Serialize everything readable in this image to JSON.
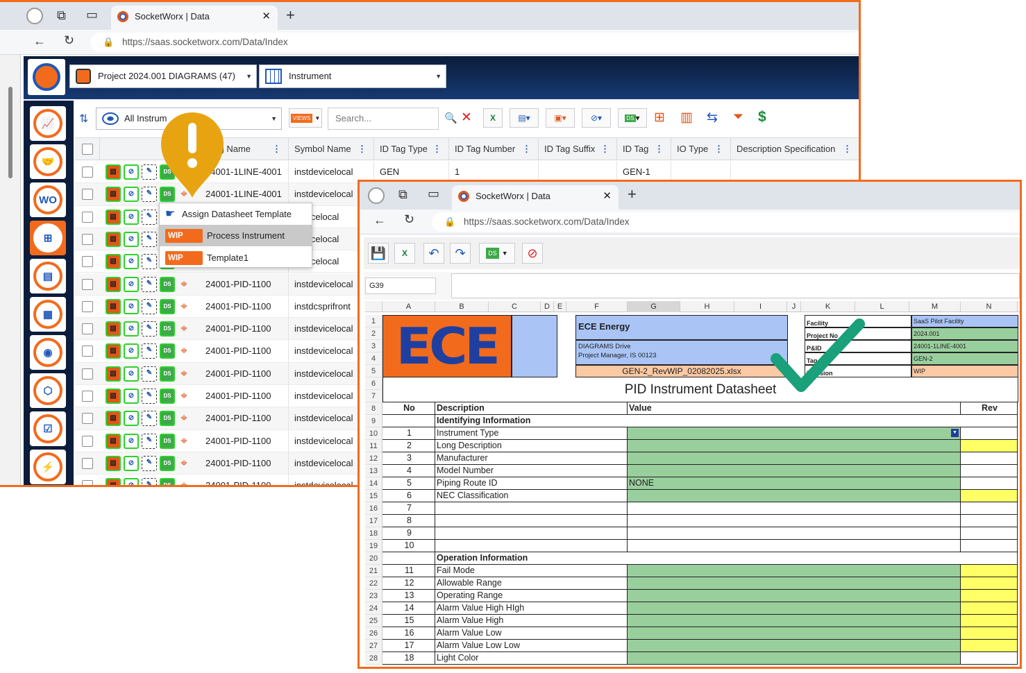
{
  "window1": {
    "tab_title": "SocketWorx | Data",
    "url": "https://saas.socketworx.com/Data/Index",
    "project_select": "Project 2024.001 DIAGRAMS (47)",
    "category_select": "Instrument",
    "filter_select": "All Instrum",
    "views_label": "VIEWS",
    "search_placeholder": "Search...",
    "columns": [
      "wing Name",
      "Symbol Name",
      "ID Tag Type",
      "ID Tag Number",
      "ID Tag Suffix",
      "ID Tag",
      "IO Type",
      "Description Specification"
    ],
    "rows": [
      {
        "drawing": "24001-1LINE-4001",
        "symbol": "instdevicelocal",
        "tag_type": "GEN",
        "tag_number": "1",
        "tag": "GEN-1"
      },
      {
        "drawing": "24001-1LINE-4001",
        "symbol": "instdevicelocal"
      },
      {
        "drawing": "",
        "symbol": "devicelocal"
      },
      {
        "drawing": "",
        "symbol": "devicelocal"
      },
      {
        "drawing": "",
        "symbol": "devicelocal"
      },
      {
        "drawing": "24001-PID-1100",
        "symbol": "instdevicelocal"
      },
      {
        "drawing": "24001-PID-1100",
        "symbol": "instdcsprifront"
      },
      {
        "drawing": "24001-PID-1100",
        "symbol": "instdevicelocal"
      },
      {
        "drawing": "24001-PID-1100",
        "symbol": "instdevicelocal"
      },
      {
        "drawing": "24001-PID-1100",
        "symbol": "instdevicelocal"
      },
      {
        "drawing": "24001-PID-1100",
        "symbol": "instdevicelocal"
      },
      {
        "drawing": "24001-PID-1100",
        "symbol": "instdevicelocal"
      },
      {
        "drawing": "24001-PID-1100",
        "symbol": "instdevicelocal"
      },
      {
        "drawing": "24001-PID-1100",
        "symbol": "instdevicelocal"
      },
      {
        "drawing": "24001-PID-1100",
        "symbol": "instdevicelocal"
      }
    ],
    "context_menu": {
      "title": "Assign Datasheet Template",
      "items": [
        {
          "badge": "WIP",
          "label": "Process Instrument"
        },
        {
          "badge": "WIP",
          "label": "Template1"
        }
      ]
    },
    "nav_icons": [
      "chart-icon",
      "handshake-icon",
      "work-order-icon",
      "grid-icon",
      "document-icon",
      "calendar-icon",
      "camera-icon",
      "cube-icon",
      "checklist-icon",
      "lightning-icon"
    ]
  },
  "window2": {
    "tab_title": "SocketWorx | Data",
    "url": "https://saas.socketworx.com/Data/Index",
    "cell_ref": "G39",
    "columns": [
      "A",
      "B",
      "C",
      "D",
      "E",
      "F",
      "G",
      "H",
      "I",
      "J",
      "K",
      "L",
      "M",
      "N"
    ],
    "logo_text": "ECE",
    "company": "ECE Energy",
    "address1": "DIAGRAMS Drive",
    "address2": "Project Manager, IS 00123",
    "filename": "GEN-2_RevWIP_02082025.xlsx",
    "info_labels": [
      "Facility",
      "Project No",
      "P&ID",
      "Tag",
      "Revision"
    ],
    "info_values": [
      "SaaS Pilot Facility",
      "2024.001",
      "24001-1LINE-4001",
      "GEN-2",
      "WIP"
    ],
    "sheet_title": "PID Instrument Datasheet",
    "header": {
      "no": "No",
      "description": "Description",
      "value": "Value",
      "rev": "Rev"
    },
    "sections": [
      {
        "row": 9,
        "title": "Identifying Information"
      },
      {
        "row": 20,
        "title": "Operation Information"
      }
    ],
    "items": [
      {
        "row": 10,
        "no": "1",
        "desc": "Instrument Type",
        "value": "",
        "green": true,
        "yellow": false
      },
      {
        "row": 11,
        "no": "2",
        "desc": "Long Description",
        "value": "",
        "green": true,
        "yellow": true
      },
      {
        "row": 12,
        "no": "3",
        "desc": "Manufacturer",
        "value": "",
        "green": true,
        "yellow": false
      },
      {
        "row": 13,
        "no": "4",
        "desc": "Model Number",
        "value": "",
        "green": true,
        "yellow": false
      },
      {
        "row": 14,
        "no": "5",
        "desc": "Piping Route ID",
        "value": "NONE",
        "green": true,
        "yellow": false
      },
      {
        "row": 15,
        "no": "6",
        "desc": "NEC Classification",
        "value": "",
        "green": true,
        "yellow": true
      },
      {
        "row": 16,
        "no": "7",
        "desc": "",
        "value": "",
        "green": false,
        "yellow": false
      },
      {
        "row": 17,
        "no": "8",
        "desc": "",
        "value": "",
        "green": false,
        "yellow": false
      },
      {
        "row": 18,
        "no": "9",
        "desc": "",
        "value": "",
        "green": false,
        "yellow": false
      },
      {
        "row": 19,
        "no": "10",
        "desc": "",
        "value": "",
        "green": false,
        "yellow": false
      },
      {
        "row": 21,
        "no": "11",
        "desc": "Fail Mode",
        "value": "",
        "green": true,
        "yellow": true
      },
      {
        "row": 22,
        "no": "12",
        "desc": "Allowable Range",
        "value": "",
        "green": true,
        "yellow": true
      },
      {
        "row": 23,
        "no": "13",
        "desc": "Operating Range",
        "value": "",
        "green": true,
        "yellow": true
      },
      {
        "row": 24,
        "no": "14",
        "desc": "Alarm Value High HIgh",
        "value": "",
        "green": true,
        "yellow": true
      },
      {
        "row": 25,
        "no": "15",
        "desc": "Alarm Value High",
        "value": "",
        "green": true,
        "yellow": true
      },
      {
        "row": 26,
        "no": "16",
        "desc": "Alarm Value Low",
        "value": "",
        "green": true,
        "yellow": true
      },
      {
        "row": 27,
        "no": "17",
        "desc": "Alarm Value Low Low",
        "value": "",
        "green": true,
        "yellow": true
      },
      {
        "row": 28,
        "no": "18",
        "desc": "Light Color",
        "value": "",
        "green": true,
        "yellow": false
      }
    ]
  },
  "colors": {
    "accent": "#f26b1d",
    "navy": "#0c1d3c",
    "brand_blue": "#1f57b7",
    "green_cell": "#99cf9d",
    "yellow_cell": "#ffff66",
    "check": "#1aa07a"
  }
}
